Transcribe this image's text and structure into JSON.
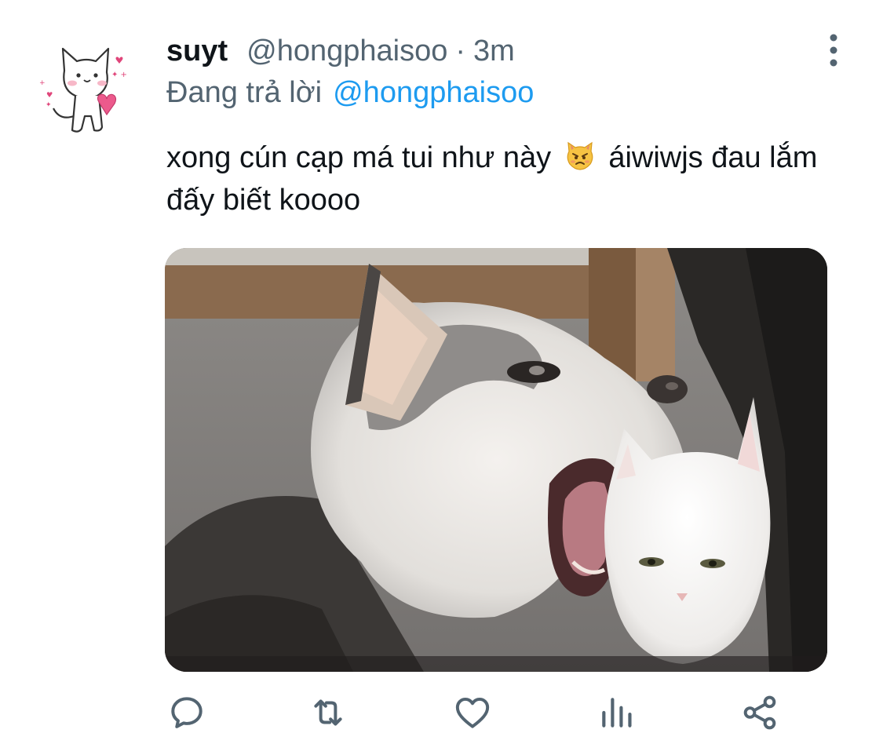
{
  "tweet": {
    "display_name": "suyt",
    "handle": "@hongphaisoo",
    "separator": "·",
    "time": "3m",
    "reply_prefix": "Đang trả lời",
    "reply_to": "@hongphaisoo",
    "text_part1": "xong cún cạp má tui như này",
    "text_part2": "áiwiwjs đau lắm đấy biết koooo",
    "emoji": "pouting-cat-emoji",
    "media": {
      "subject": "husky-dog-biting-white-cat-photo"
    }
  },
  "actions": {
    "icons": [
      "reply-icon",
      "retweet-icon",
      "like-icon",
      "analytics-icon",
      "share-icon"
    ]
  },
  "colors": {
    "text_primary": "#0f1419",
    "text_secondary": "#536471",
    "link": "#1d9bf0",
    "icon": "#536471"
  }
}
